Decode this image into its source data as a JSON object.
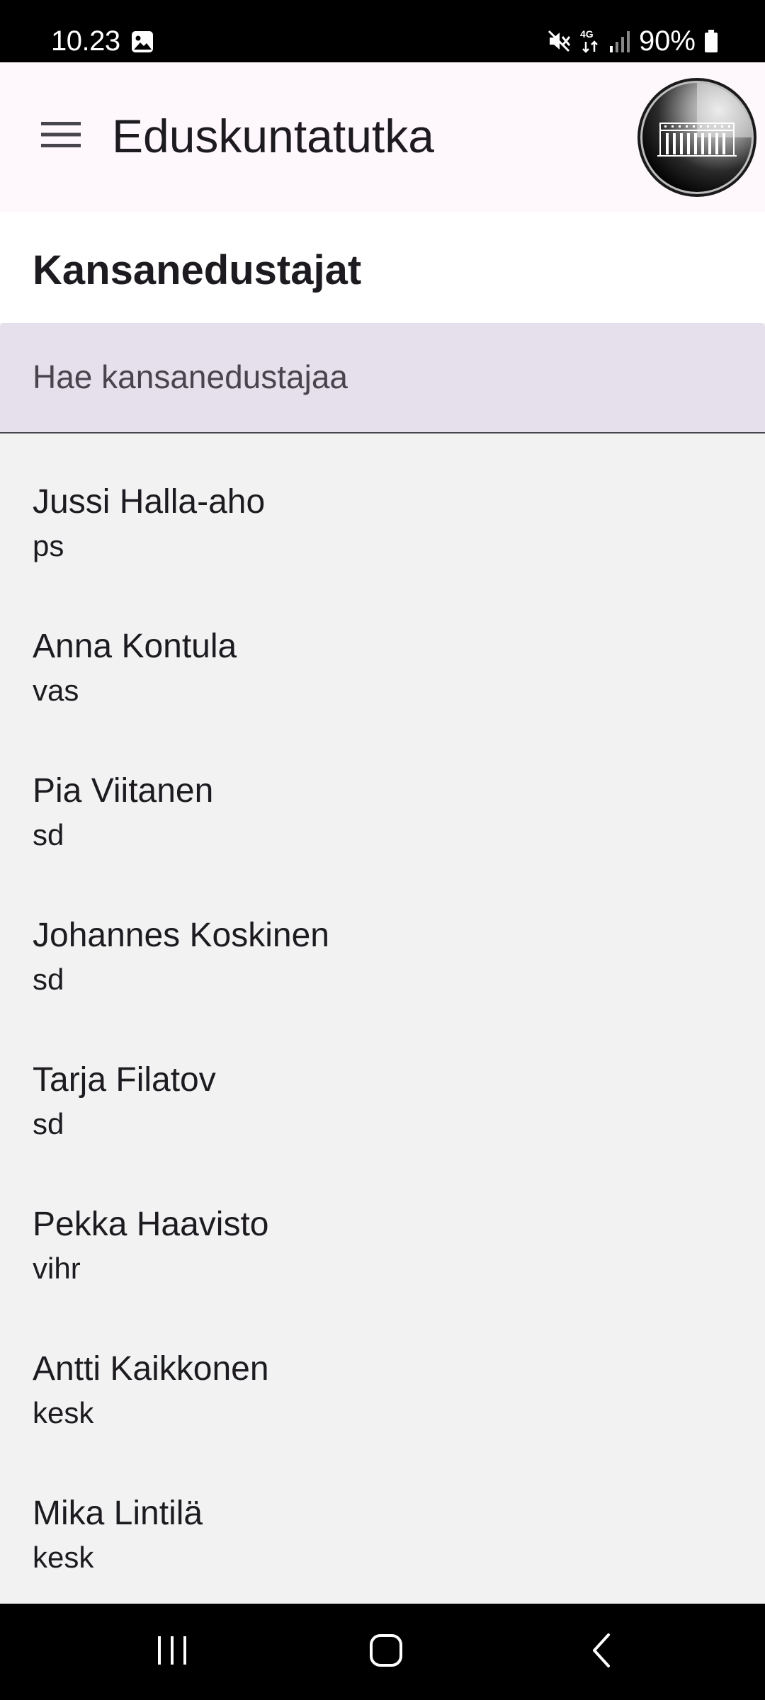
{
  "status_bar": {
    "time": "10.23",
    "battery": "90%",
    "icons": [
      "gallery-icon",
      "mute-icon",
      "network-4g-icon",
      "signal-icon",
      "battery-icon"
    ]
  },
  "app_bar": {
    "title": "Eduskuntatutka",
    "menu_icon": "menu-icon",
    "logo": "parliament-logo"
  },
  "page": {
    "title": "Kansanedustajat"
  },
  "search": {
    "placeholder": "Hae kansanedustajaa",
    "value": ""
  },
  "members": [
    {
      "name": "Jussi Halla-aho",
      "party": "ps"
    },
    {
      "name": "Anna Kontula",
      "party": "vas"
    },
    {
      "name": "Pia Viitanen",
      "party": "sd"
    },
    {
      "name": "Johannes Koskinen",
      "party": "sd"
    },
    {
      "name": "Tarja Filatov",
      "party": "sd"
    },
    {
      "name": "Pekka Haavisto",
      "party": "vihr"
    },
    {
      "name": "Antti Kaikkonen",
      "party": "kesk"
    },
    {
      "name": "Mika Lintilä",
      "party": "kesk"
    }
  ],
  "nav_bar": {
    "buttons": [
      "recents-icon",
      "home-icon",
      "back-icon"
    ]
  },
  "colors": {
    "app_bar_bg": "#fef7fc",
    "search_bg": "#e6e0ec",
    "list_bg": "#f2f2f2",
    "text": "#1d1b20"
  }
}
